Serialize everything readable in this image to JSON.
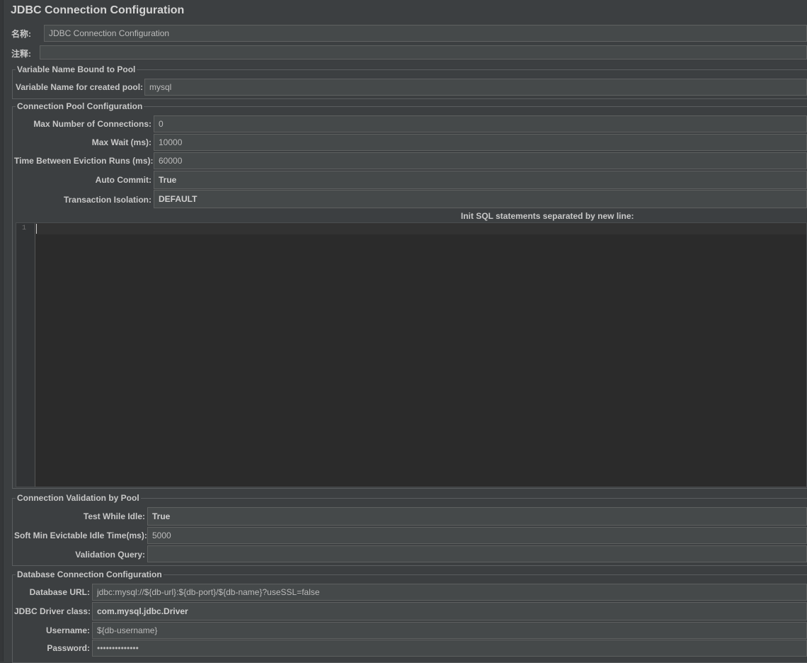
{
  "window": {
    "title": "JDBC Connection Configuration"
  },
  "meta": {
    "name_label": "名称:",
    "name_value": "JDBC Connection Configuration",
    "comment_label": "注释:",
    "comment_value": ""
  },
  "variable_group": {
    "title": "Variable Name Bound to Pool",
    "pool_var_label": "Variable Name for created pool:",
    "pool_var_value": "mysql"
  },
  "pool_group": {
    "title": "Connection Pool Configuration",
    "max_conn_label": "Max Number of Connections:",
    "max_conn_value": "0",
    "max_wait_label": "Max Wait (ms):",
    "max_wait_value": "10000",
    "eviction_label": "Time Between Eviction Runs (ms):",
    "eviction_value": "60000",
    "auto_commit_label": "Auto Commit:",
    "auto_commit_value": "True",
    "isolation_label": "Transaction Isolation:",
    "isolation_value": "DEFAULT",
    "init_sql_label": "Init SQL statements separated by new line:",
    "line_number": "1"
  },
  "validation_group": {
    "title": "Connection Validation by Pool",
    "test_idle_label": "Test While Idle:",
    "test_idle_value": "True",
    "soft_min_label": "Soft Min Evictable Idle Time(ms):",
    "soft_min_value": "5000",
    "validation_query_label": "Validation Query:",
    "validation_query_value": ""
  },
  "db_group": {
    "title": "Database Connection Configuration",
    "url_label": "Database URL:",
    "url_value": "jdbc:mysql://${db-url}:${db-port}/${db-name}?useSSL=false",
    "driver_label": "JDBC Driver class:",
    "driver_value": "com.mysql.jdbc.Driver",
    "username_label": "Username:",
    "username_value": "${db-username}",
    "password_label": "Password:",
    "password_value": "••••••••••••••"
  }
}
